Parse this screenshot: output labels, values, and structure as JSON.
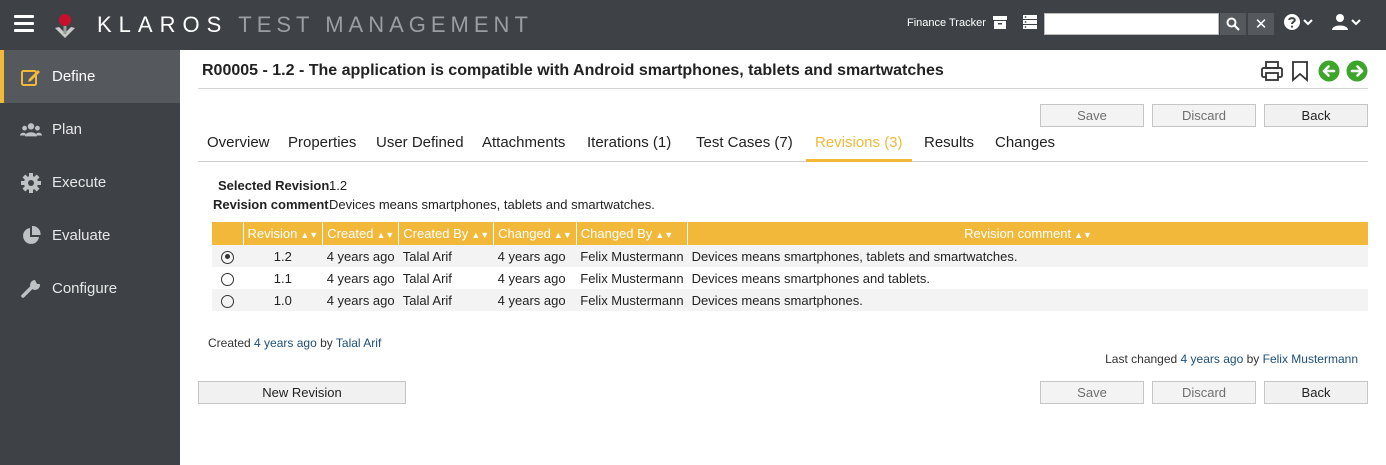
{
  "app": {
    "brand_main": "KLAROS",
    "brand_sub": "TEST MANAGEMENT",
    "project_name": "Finance Tracker",
    "search_placeholder": "",
    "clear_symbol": "✕"
  },
  "sidebar": {
    "items": [
      {
        "label": "Define",
        "icon": "edit-icon"
      },
      {
        "label": "Plan",
        "icon": "users-icon"
      },
      {
        "label": "Execute",
        "icon": "gear-icon"
      },
      {
        "label": "Evaluate",
        "icon": "pie-chart-icon"
      },
      {
        "label": "Configure",
        "icon": "wrench-icon"
      }
    ]
  },
  "page": {
    "title": "R00005 - 1.2 - The application is compatible with Android smartphones, tablets and smartwatches"
  },
  "buttons": {
    "save": "Save",
    "discard": "Discard",
    "back": "Back",
    "new_revision": "New Revision"
  },
  "tabs": [
    {
      "label": "Overview"
    },
    {
      "label": "Properties"
    },
    {
      "label": "User Defined"
    },
    {
      "label": "Attachments"
    },
    {
      "label": "Iterations (1)"
    },
    {
      "label": "Test Cases (7)"
    },
    {
      "label": "Revisions (3)"
    },
    {
      "label": "Results"
    },
    {
      "label": "Changes"
    }
  ],
  "selected_revision": {
    "label": "Selected Revision",
    "value": "1.2",
    "comment_label": "Revision comment",
    "comment_value": "Devices means smartphones, tablets and smartwatches."
  },
  "table": {
    "headers": [
      "Revision",
      "Created",
      "Created By",
      "Changed",
      "Changed By",
      "Revision comment"
    ],
    "rows": [
      {
        "revision": "1.2",
        "created": "4 years ago",
        "created_by": "Talal Arif",
        "changed": "4 years ago",
        "changed_by": "Felix Mustermann",
        "comment": "Devices means smartphones, tablets and smartwatches.",
        "selected": true
      },
      {
        "revision": "1.1",
        "created": "4 years ago",
        "created_by": "Talal Arif",
        "changed": "4 years ago",
        "changed_by": "Felix Mustermann",
        "comment": "Devices means smartphones and tablets.",
        "selected": false
      },
      {
        "revision": "1.0",
        "created": "4 years ago",
        "created_by": "Talal Arif",
        "changed": "4 years ago",
        "changed_by": "Felix Mustermann",
        "comment": "Devices means smartphones.",
        "selected": false
      }
    ]
  },
  "footer_meta": {
    "created_prefix": "Created",
    "created_when": "4 years ago",
    "by": "by",
    "created_by": "Talal Arif",
    "changed_prefix": "Last changed",
    "changed_when": "4 years ago",
    "changed_by": "Felix Mustermann"
  },
  "colors": {
    "accent": "#f2b83a",
    "topbar": "#3e4247",
    "nav_green": "#3ca52a",
    "link": "#1d4f7a"
  }
}
